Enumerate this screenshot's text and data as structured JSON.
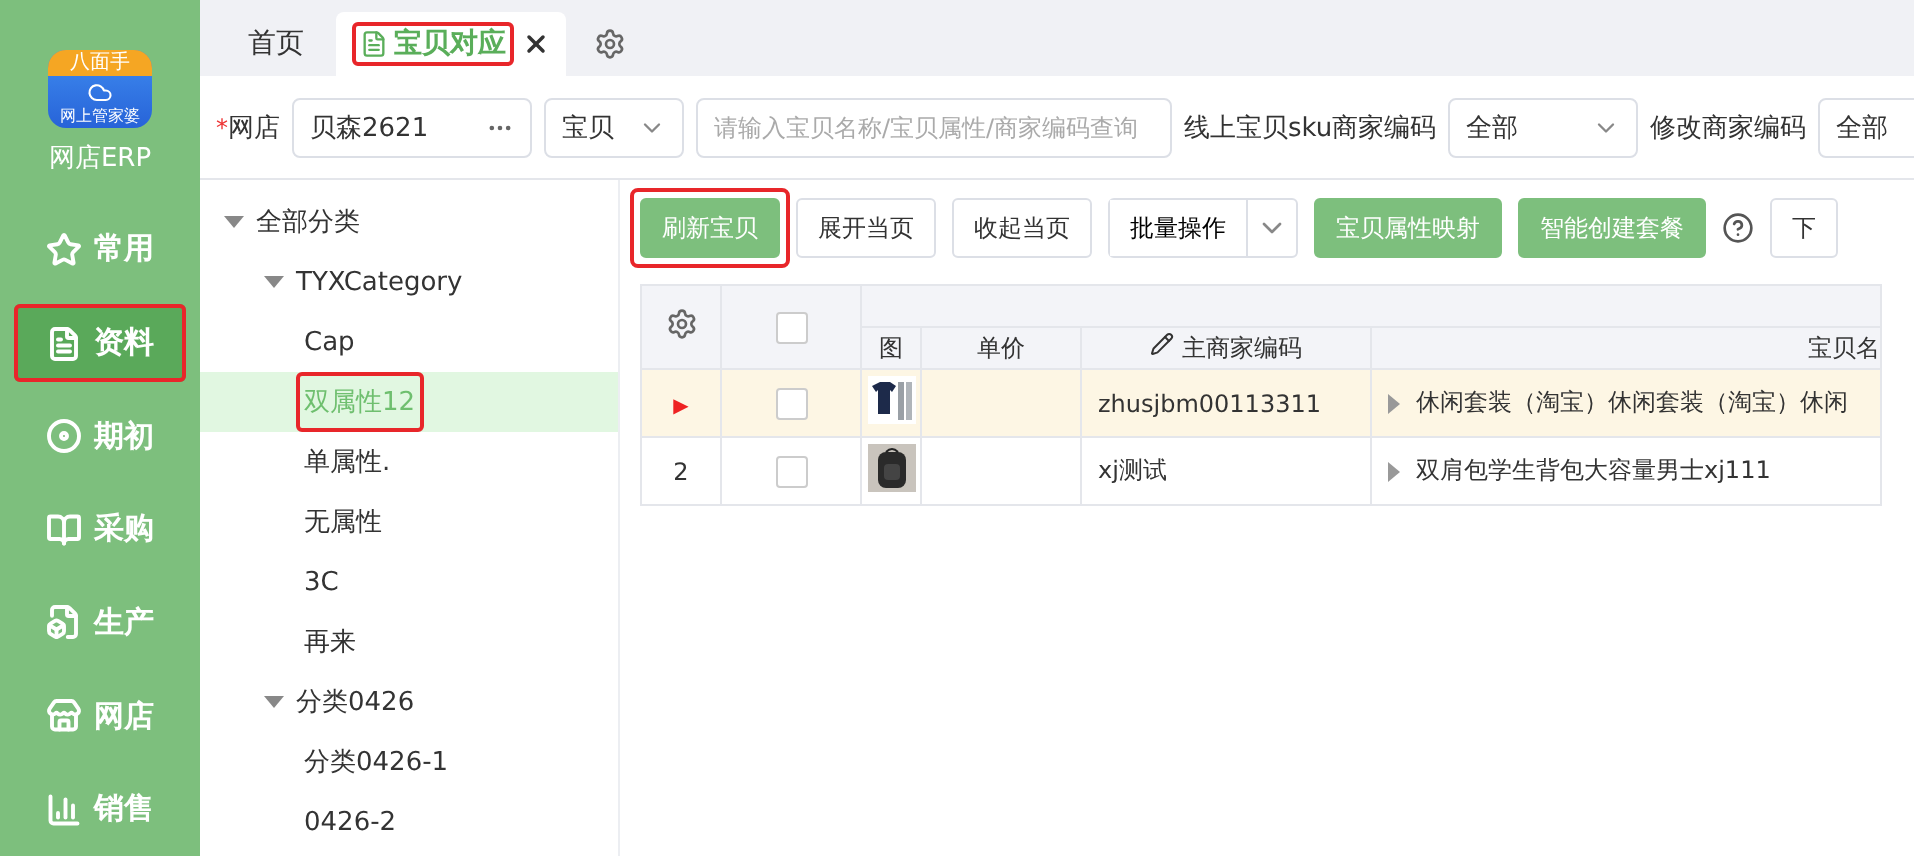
{
  "logo": {
    "badge": "八面手",
    "caption": "网上管家婆",
    "app_name": "网店ERP"
  },
  "nav": [
    {
      "label": "常用",
      "selected": false,
      "highlighted": false
    },
    {
      "label": "资料",
      "selected": true,
      "highlighted": true
    },
    {
      "label": "期初",
      "selected": false,
      "highlighted": false
    },
    {
      "label": "采购",
      "selected": false,
      "highlighted": false
    },
    {
      "label": "生产",
      "selected": false,
      "highlighted": false
    },
    {
      "label": "网店",
      "selected": false,
      "highlighted": false
    },
    {
      "label": "销售",
      "selected": false,
      "highlighted": false
    }
  ],
  "tabs": [
    {
      "label": "首页",
      "selected": false,
      "closable": false,
      "highlighted": false
    },
    {
      "label": "宝贝对应",
      "selected": true,
      "closable": true,
      "highlighted": true
    }
  ],
  "filters": {
    "shop_label": "网店",
    "required_mark": "*",
    "shop_value": "贝森2621",
    "scope_value": "宝贝",
    "search_placeholder": "请输入宝贝名称/宝贝属性/商家编码查询",
    "sku_label": "线上宝贝sku商家编码",
    "sku_value": "全部",
    "edit_label": "修改商家编码",
    "edit_value": "全部"
  },
  "tree": [
    {
      "label": "全部分类",
      "expanded": true,
      "selected": false,
      "highlighted": false,
      "children": [
        {
          "label": "TYXCategory",
          "expanded": true,
          "selected": false,
          "highlighted": false,
          "children": [
            {
              "label": "Cap",
              "selected": false,
              "highlighted": false
            },
            {
              "label": "双属性12",
              "selected": true,
              "highlighted": true
            },
            {
              "label": "单属性.",
              "selected": false,
              "highlighted": false
            },
            {
              "label": "无属性",
              "selected": false,
              "highlighted": false
            },
            {
              "label": "3C",
              "selected": false,
              "highlighted": false
            },
            {
              "label": "再来",
              "selected": false,
              "highlighted": false
            }
          ]
        },
        {
          "label": "分类0426",
          "expanded": true,
          "selected": false,
          "highlighted": false,
          "children": [
            {
              "label": "分类0426-1",
              "selected": false,
              "highlighted": false
            },
            {
              "label": "0426-2",
              "selected": false,
              "highlighted": false
            }
          ]
        }
      ]
    }
  ],
  "toolbar": [
    {
      "label": "刷新宝贝",
      "kind": "primary",
      "highlighted": true
    },
    {
      "label": "展开当页",
      "kind": "plain",
      "highlighted": false
    },
    {
      "label": "收起当页",
      "kind": "plain",
      "highlighted": false
    },
    {
      "label": "批量操作",
      "kind": "split",
      "highlighted": false
    },
    {
      "label": "宝贝属性映射",
      "kind": "primary",
      "highlighted": false
    },
    {
      "label": "智能创建套餐",
      "kind": "primary",
      "highlighted": false
    },
    {
      "label": "下",
      "kind": "plain",
      "highlighted": false
    }
  ],
  "table": {
    "header_checked": false,
    "columns": [
      "图",
      "单价",
      "主商家编码",
      "宝贝名"
    ],
    "rows": [
      {
        "index": "▶",
        "current": true,
        "checked": false,
        "code": "zhusjbm00113311",
        "name": "休闲套装（淘宝）休闲套装（淘宝）休闲"
      },
      {
        "index": "2",
        "current": false,
        "checked": false,
        "code": "xj测试",
        "name": "双肩包学生背包大容量男士xj111"
      }
    ]
  }
}
